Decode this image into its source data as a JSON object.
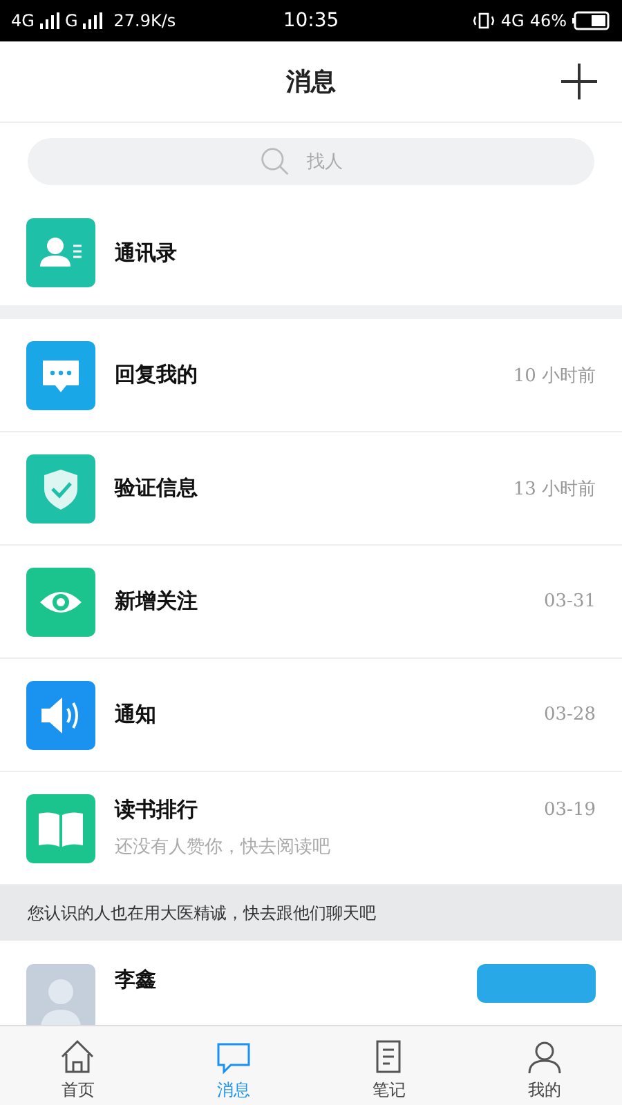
{
  "status_bar": {
    "network_1": "4G",
    "network_2": "G",
    "speed": "27.9K/s",
    "time": "10:35",
    "network_3": "4G",
    "battery": "46%"
  },
  "header": {
    "title": "消息"
  },
  "search": {
    "placeholder": "找人"
  },
  "contacts_entry": {
    "label": "通讯录"
  },
  "messages": [
    {
      "kind": "chat",
      "title": "回复我的",
      "time": "10 小时前",
      "color": "#1aa7e8"
    },
    {
      "kind": "shield",
      "title": "验证信息",
      "time": "13 小时前",
      "color": "#1fc0a8"
    },
    {
      "kind": "eye",
      "title": "新增关注",
      "time": "03-31",
      "color": "#1cc48d"
    },
    {
      "kind": "speaker",
      "title": "通知",
      "time": "03-28",
      "color": "#1a92f0"
    },
    {
      "kind": "book",
      "title": "读书排行",
      "time": "03-19",
      "subtitle": "还没有人赞你，快去阅读吧",
      "color": "#1cc48d"
    }
  ],
  "suggestion_banner": "您认识的人也在用大医精诚，快去跟他们聊天吧",
  "suggested_people": [
    {
      "name": "李鑫"
    }
  ],
  "tab_bar": [
    {
      "kind": "home",
      "label": "首页",
      "selected": false
    },
    {
      "kind": "chat",
      "label": "消息",
      "selected": true
    },
    {
      "kind": "note",
      "label": "笔记",
      "selected": false
    },
    {
      "kind": "user",
      "label": "我的",
      "selected": false
    }
  ]
}
